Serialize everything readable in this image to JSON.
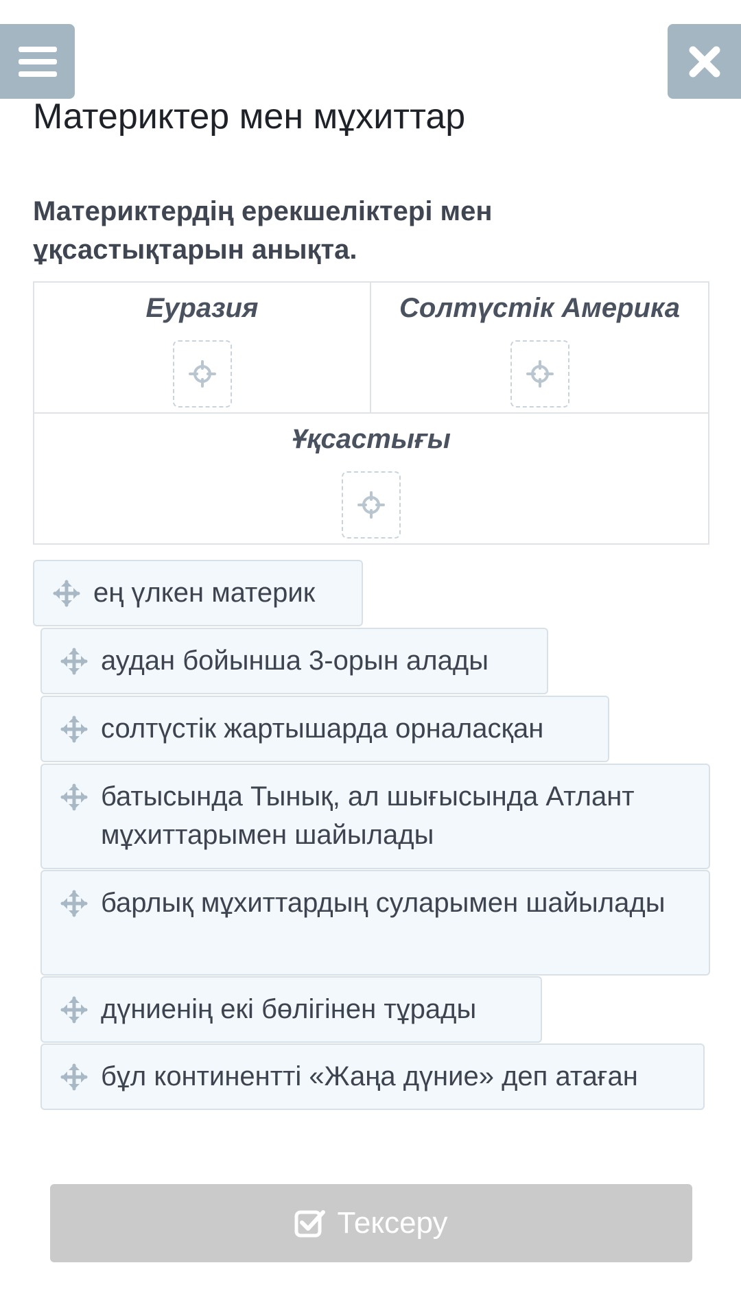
{
  "header": {
    "menu_icon": "hamburger-icon",
    "close_icon": "close-icon",
    "title": "Материктер мен мұхиттар"
  },
  "question": {
    "text": "Материктердің ерекшеліктері мен ұқсастықтарын анықта."
  },
  "categories": {
    "left": {
      "label": "Еуразия",
      "icon": "crosshair-icon"
    },
    "right": {
      "label": "Солтүстік Америка",
      "icon": "crosshair-icon"
    },
    "bottom": {
      "label": "Ұқсастығы",
      "icon": "crosshair-icon"
    }
  },
  "items": [
    "ең үлкен материк",
    "аудан бойынша 3-орын алады",
    "солтүстік жартышарда орналасқан",
    "батысында Тынық, ал шығысында Атлант мұхиттарымен шайылады",
    "барлық мұхиттардың суларымен шайылады",
    "дүниенің екі бөлігінен тұрады",
    "бұл континентті «Жаңа дүние» деп атаған"
  ],
  "check_button": {
    "label": "Тексеру",
    "icon": "checkbox-icon"
  },
  "colors": {
    "top_button": "#a3b6c1",
    "item_background": "#f3f8fc",
    "item_border": "#d8e1e8",
    "check_button": "#cacaca"
  }
}
